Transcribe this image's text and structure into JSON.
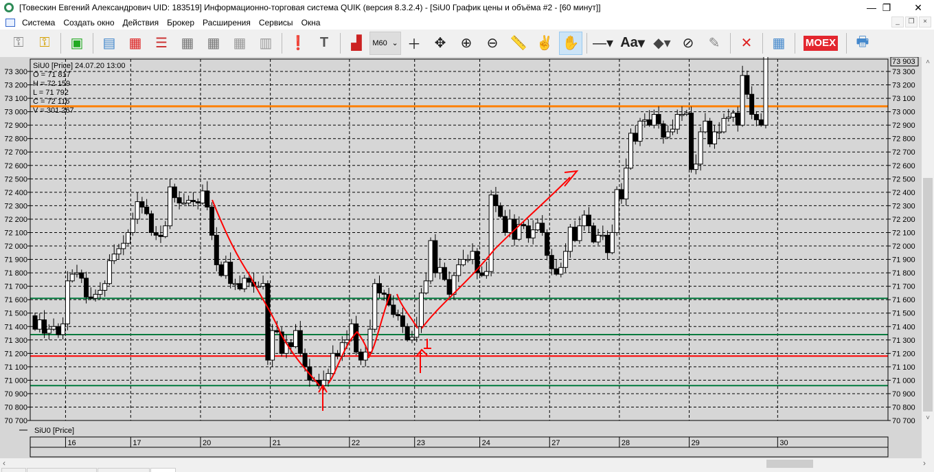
{
  "window": {
    "title": "[Товескин Евгений Александрович UID: 183519] Информационно-торговая система QUIK (версия 8.3.2.4) - [SiU0 График цены и объёма #2 - [60 минут]]",
    "minimize": "—",
    "maximize": "❐",
    "close": "✕"
  },
  "menu": [
    "Система",
    "Создать окно",
    "Действия",
    "Брокер",
    "Расширения",
    "Сервисы",
    "Окна"
  ],
  "mdi": [
    "_",
    "❐",
    "×"
  ],
  "toolbar": {
    "interval": "M60",
    "interval_arrow": "⌄",
    "moex": "MOEX",
    "font_btn": "Aa"
  },
  "legend": {
    "header": "SiU0 [Price] 24.07.20 13:00",
    "o": "O = 71 817",
    "h": "H = 72 159",
    "l": "L = 71 792",
    "c": "C = 72 116",
    "v": "V = 301 267"
  },
  "series_label": "SiU0 [Price]",
  "last_price_label": "73 903",
  "colors": {
    "orange": "#ff8000",
    "green": "#007a3d",
    "red": "#ff0000",
    "bg": "#d6d6d6"
  },
  "chart_data": {
    "type": "candlestick",
    "instrument": "SiU0 [Price]",
    "interval": "60 минут",
    "ylim": [
      70700,
      73903
    ],
    "yticks": [
      70700,
      70800,
      70900,
      71000,
      71100,
      71200,
      71300,
      71400,
      71500,
      71600,
      71700,
      71800,
      71900,
      72000,
      72100,
      72200,
      72300,
      72400,
      72500,
      72600,
      72700,
      72800,
      72900,
      73000,
      73100,
      73200,
      73300
    ],
    "ytick_labels": [
      "70 700",
      "70 800",
      "70 900",
      "71 000",
      "71 100",
      "71 200",
      "71 300",
      "71 400",
      "71 500",
      "71 600",
      "71 700",
      "71 800",
      "71 900",
      "72 000",
      "72 100",
      "72 200",
      "72 300",
      "72 400",
      "72 500",
      "72 600",
      "72 700",
      "72 800",
      "72 900",
      "73 000",
      "73 100",
      "73 200",
      "73 300"
    ],
    "days": [
      "16",
      "17",
      "20",
      "21",
      "22",
      "23",
      "24",
      "27",
      "28",
      "29",
      "30"
    ],
    "day_start_index": [
      7,
      21,
      36,
      51,
      68,
      82,
      96,
      111,
      126,
      141,
      160
    ],
    "first_open": 71480,
    "closes": [
      71380,
      71450,
      71350,
      71380,
      71400,
      71340,
      71420,
      71740,
      71790,
      71800,
      71760,
      71620,
      71610,
      71640,
      71670,
      71720,
      71890,
      71940,
      71980,
      72020,
      72100,
      72200,
      72330,
      72290,
      72240,
      72100,
      72080,
      72070,
      72150,
      72440,
      72360,
      72320,
      72320,
      72340,
      72330,
      72320,
      72410,
      72290,
      72080,
      71860,
      71780,
      71880,
      71720,
      71720,
      71680,
      71760,
      71730,
      71700,
      71700,
      71720,
      71150,
      71370,
      71360,
      71200,
      71280,
      71250,
      71370,
      71200,
      71100,
      71000,
      71000,
      70960,
      71000,
      71050,
      71200,
      71180,
      71280,
      71300,
      71420,
      71210,
      71150,
      71210,
      71380,
      71720,
      71650,
      71640,
      71560,
      71490,
      71480,
      71400,
      71300,
      71320,
      71400,
      71650,
      71740,
      72040,
      71800,
      71840,
      71750,
      71640,
      71780,
      71860,
      71900,
      71900,
      71960,
      71800,
      71780,
      71810,
      72380,
      72300,
      72220,
      72100,
      72200,
      72050,
      72160,
      72150,
      72060,
      72120,
      72170,
      72100,
      71930,
      71830,
      71790,
      71840,
      71960,
      72140,
      72040,
      72150,
      72230,
      72150,
      72030,
      72080,
      72080,
      71950,
      72100,
      72420,
      72350,
      72580,
      72840,
      72780,
      72930,
      72940,
      72900,
      72980,
      72910,
      72810,
      72850,
      72870,
      72980,
      72980,
      72990,
      72570,
      72610,
      72850,
      72930,
      72760,
      72850,
      72850,
      72950,
      72960,
      72990,
      72900,
      73270,
      73130,
      72980,
      72940,
      72900,
      73903
    ],
    "levels": [
      {
        "price": 73040,
        "color": "#ff8000",
        "width": 3
      },
      {
        "price": 71610,
        "color": "#007a3d",
        "width": 2
      },
      {
        "price": 71340,
        "color": "#007a3d",
        "width": 2
      },
      {
        "price": 71180,
        "color": "#ff0000",
        "width": 2
      },
      {
        "price": 70960,
        "color": "#007a3d",
        "width": 2
      }
    ],
    "grid": true
  }
}
